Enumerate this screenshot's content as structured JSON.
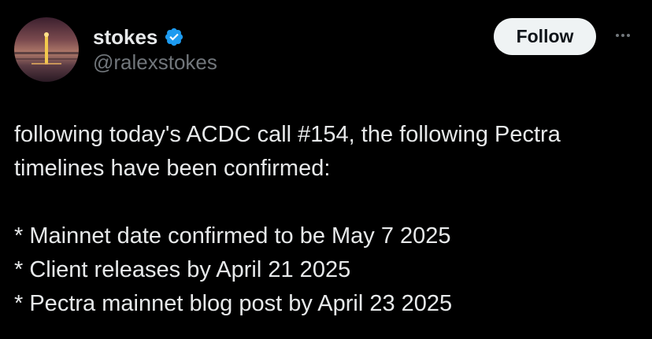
{
  "tweet": {
    "author": {
      "display_name": "stokes",
      "handle": "@ralexstokes",
      "verified": true,
      "verified_icon": "verified-badge-icon",
      "badge_color": "#1d9bf0"
    },
    "follow_label": "Follow",
    "more_icon": "more-options-icon",
    "text_lines": [
      "following today's ACDC call #154, the following Pectra",
      "timelines have been confirmed:",
      "",
      "* Mainnet date confirmed to be May 7 2025",
      "* Client releases by April 21 2025",
      "* Pectra mainnet blog post by April 23 2025"
    ]
  },
  "colors": {
    "background": "#000000",
    "primary_text": "#e7e9ea",
    "secondary_text": "#71767b",
    "follow_bg": "#eff3f4",
    "follow_text": "#0f1419"
  }
}
